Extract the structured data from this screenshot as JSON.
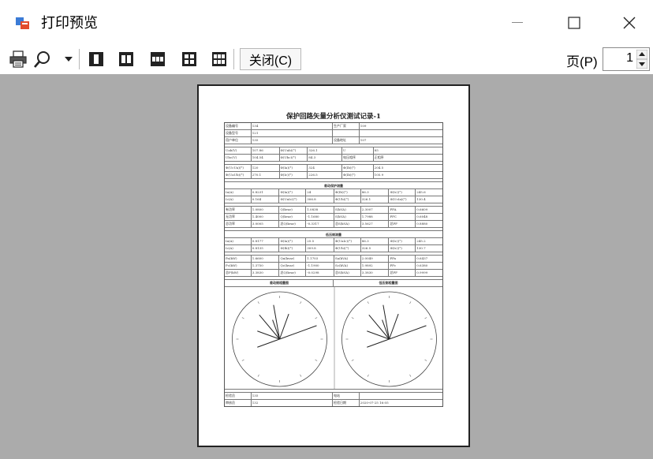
{
  "window": {
    "title": "打印预览",
    "minimize_glyph": "—",
    "maximize_glyph": "☐",
    "close_glyph": "✕"
  },
  "toolbar": {
    "icons": [
      "printer-icon",
      "zoom-icon",
      "zoom-dropdown-icon",
      "one-page-icon",
      "two-pages-icon",
      "three-pages-icon",
      "four-pages-icon",
      "six-pages-icon"
    ],
    "close_label": "关闭(C)",
    "page_label": "页(P)",
    "page_value": "1"
  },
  "document": {
    "title": "保护回路矢量分析仪测试记录-1",
    "info_rows": [
      [
        "设备编号",
        "134",
        "生产厂家",
        "109"
      ],
      [
        "设备型号",
        "121",
        "",
        ""
      ],
      [
        "用户单位",
        "135",
        "设备地址",
        "107"
      ]
    ],
    "volt_rows": [
      [
        "Uab(V)",
        "107.86",
        "Φ(Uab)(°)",
        "326.1",
        "U",
        "85"
      ],
      [
        "Ubc(V)",
        "104.54",
        "Φ(Ubc)(°)",
        "84.3",
        "电压相序",
        "正相序"
      ]
    ],
    "phase_rows": [
      [
        "Φ(UcUa)(°)",
        "120",
        "Φ(Ia)(°)",
        "324",
        "Φ(Ib)(°)",
        "204.5"
      ],
      [
        "Φ(UaUb)(°)",
        "270.1",
        "Φ(Ic)(°)",
        "226.5",
        "Φ(Ib)(°)",
        "105.9"
      ]
    ],
    "section1": "差动保护测量",
    "sec1_rows_a": [
      [
        "Ia(A)",
        "0.8231",
        "Φ(Ia)(°)",
        "24",
        "Φ(Ib)(°)",
        "86.3",
        "Φ(Ic)(°)",
        "245.6"
      ],
      [
        "Ic(A)",
        "0.164",
        "Φ(UaIc)(°)",
        "306.8",
        "Φ(Ub)(°)",
        "326.1",
        "Φ(UcIa)(°)",
        "130.4"
      ]
    ],
    "sec1_rows_b": [
      [
        "有功率",
        "1.0800",
        "Q(kvar)",
        "1.0838",
        "S(kVA)",
        "2.3007",
        "PFA",
        "0.6609"
      ],
      [
        "无功率",
        "1.4000",
        "Q(kvar)",
        "-1.1680",
        "S(kVA)",
        "1.7988",
        "PFC",
        "0.6048"
      ],
      [
        "总功率",
        "3.0005",
        "总Q(kvar)",
        "-0.3317",
        "总S(kVA)",
        "3.5627",
        "总PF",
        "0.8880"
      ]
    ],
    "section2": "低压侧测量",
    "sec2_rows_a": [
      [
        "Ia(A)",
        "0.8177",
        "Φ(Ia)(°)",
        "25.5",
        "Φ(UaIc)(°)",
        "86.3",
        "Φ(Ic)(°)",
        "245.2"
      ],
      [
        "Ic(A)",
        "0.8135",
        "Φ(Ib)(°)",
        "309.8",
        "Φ(Ub)(°)",
        "326.5",
        "Φ(Ic)(°)",
        "130.7"
      ]
    ],
    "sec2_rows_b": [
      [
        "Pa(kW)",
        "1.6600",
        "Qa(kvar)",
        "1.1703",
        "Sa(kVA)",
        "2.0049",
        "PFa",
        "0.6437"
      ],
      [
        "Pc(kW)",
        "1.3750",
        "Qc(kvar)",
        "-1.1900",
        "Sc(kVA)",
        "1.9892",
        "PFc",
        "0.6380"
      ],
      [
        "总P(kW)",
        "3.3830",
        "总Q(kvar)",
        "-0.0298",
        "总S(kVA)",
        "3.3830",
        "总PF",
        "0.9999"
      ]
    ],
    "diagram_left_title": "差动侧相量图",
    "diagram_right_title": "低压侧相量图",
    "footer_rows": [
      [
        "检验员",
        "135",
        "电站",
        ""
      ],
      [
        "审核员",
        "132",
        "检验日期",
        "2020-07-25 16:05"
      ]
    ]
  },
  "colors": {
    "preview_background": "#ababab",
    "paper_background": "#ffffff"
  }
}
